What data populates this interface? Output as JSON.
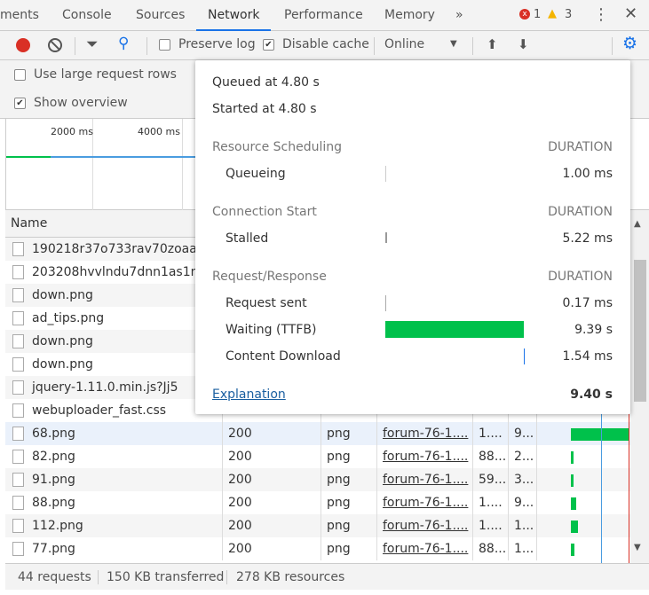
{
  "tabs": [
    {
      "label": "ments"
    },
    {
      "label": "Console"
    },
    {
      "label": "Sources"
    },
    {
      "label": "Network"
    },
    {
      "label": "Performance"
    },
    {
      "label": "Memory"
    },
    {
      "label": "»"
    }
  ],
  "status": {
    "errors": "1",
    "warnings": "3"
  },
  "toolbar": {
    "preserve_log": "Preserve log",
    "preserve_checked": false,
    "disable_cache": "Disable cache",
    "disable_checked": true,
    "throttle": "Online"
  },
  "settings": {
    "large_rows": "Use large request rows",
    "show_overview": "Show overview"
  },
  "overview": {
    "ticks": [
      "2000 ms",
      "4000 ms"
    ]
  },
  "table": {
    "header_name": "Name",
    "rows": [
      {
        "name": "190218r37o733rav70zoaa.png",
        "status": "",
        "type": "",
        "initiator": "",
        "size": "",
        "time": ""
      },
      {
        "name": "203208hvvlndu7dnn1as1n.png",
        "status": "",
        "type": "",
        "initiator": "",
        "size": "",
        "time": ""
      },
      {
        "name": "down.png",
        "status": "",
        "type": "",
        "initiator": "",
        "size": "",
        "time": ""
      },
      {
        "name": "ad_tips.png",
        "status": "",
        "type": "",
        "initiator": "",
        "size": "",
        "time": ""
      },
      {
        "name": "down.png",
        "status": "",
        "type": "",
        "initiator": "",
        "size": "",
        "time": ""
      },
      {
        "name": "down.png",
        "status": "",
        "type": "",
        "initiator": "",
        "size": "",
        "time": ""
      },
      {
        "name": "jquery-1.11.0.min.js?Jj5",
        "status": "",
        "type": "",
        "initiator": "",
        "size": "",
        "time": ""
      },
      {
        "name": "webuploader_fast.css",
        "status": "",
        "type": "",
        "initiator": "",
        "size": "",
        "time": ""
      },
      {
        "name": "68.png",
        "status": "200",
        "type": "png",
        "initiator": "forum-76-1....",
        "size": "1....",
        "time": "9..."
      },
      {
        "name": "82.png",
        "status": "200",
        "type": "png",
        "initiator": "forum-76-1....",
        "size": "88...",
        "time": "2..."
      },
      {
        "name": "91.png",
        "status": "200",
        "type": "png",
        "initiator": "forum-76-1....",
        "size": "59...",
        "time": "3..."
      },
      {
        "name": "88.png",
        "status": "200",
        "type": "png",
        "initiator": "forum-76-1....",
        "size": "1....",
        "time": "9..."
      },
      {
        "name": "112.png",
        "status": "200",
        "type": "png",
        "initiator": "forum-76-1....",
        "size": "1....",
        "time": "1..."
      },
      {
        "name": "77.png",
        "status": "200",
        "type": "png",
        "initiator": "forum-76-1....",
        "size": "88...",
        "time": "1..."
      }
    ]
  },
  "footer": {
    "requests": "44 requests",
    "transferred": "150 KB transferred",
    "resources": "278 KB resources"
  },
  "popover": {
    "queued": "Queued at 4.80 s",
    "started": "Started at 4.80 s",
    "duration_label": "DURATION",
    "sections": [
      {
        "title": "Resource Scheduling",
        "items": [
          {
            "label": "Queueing",
            "value": "1.00 ms"
          }
        ]
      },
      {
        "title": "Connection Start",
        "items": [
          {
            "label": "Stalled",
            "value": "5.22 ms"
          }
        ]
      },
      {
        "title": "Request/Response",
        "items": [
          {
            "label": "Request sent",
            "value": "0.17 ms"
          },
          {
            "label": "Waiting (TTFB)",
            "value": "9.39 s"
          },
          {
            "label": "Content Download",
            "value": "1.54 ms"
          }
        ]
      }
    ],
    "explanation": "Explanation",
    "total": "9.40 s"
  },
  "colors": {
    "accent": "#1a73e8",
    "ttfb": "#00c14b",
    "record": "#d93025"
  }
}
